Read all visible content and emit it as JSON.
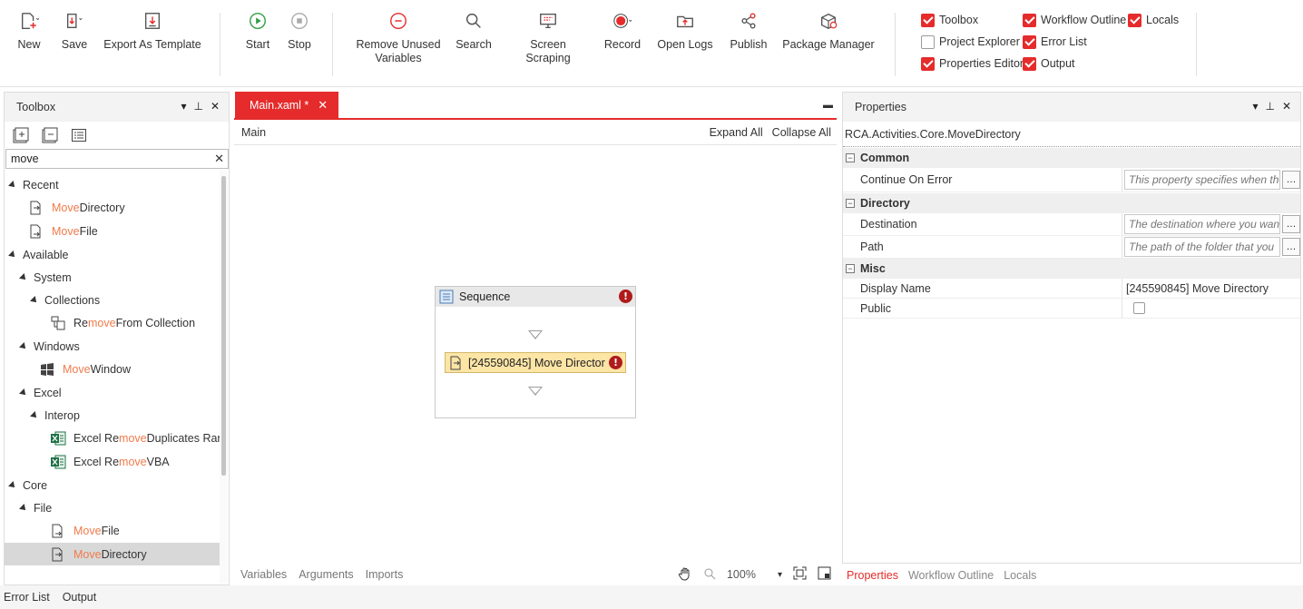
{
  "ribbon": {
    "new": "New",
    "save": "Save",
    "export_template": "Export As Template",
    "start": "Start",
    "stop": "Stop",
    "remove_unused_line1": "Remove Unused",
    "remove_unused_line2": "Variables",
    "search": "Search",
    "screen_scraping": "Screen Scraping",
    "record": "Record",
    "open_logs": "Open Logs",
    "publish": "Publish",
    "package_manager": "Package Manager"
  },
  "view_toggles": {
    "toolbox": {
      "label": "Toolbox",
      "checked": true
    },
    "project_explorer": {
      "label": "Project Explorer",
      "checked": false
    },
    "properties_editor": {
      "label": "Properties Editor",
      "checked": true
    },
    "workflow_outline": {
      "label": "Workflow Outline",
      "checked": true
    },
    "error_list": {
      "label": "Error List",
      "checked": true
    },
    "output": {
      "label": "Output",
      "checked": true
    },
    "locals": {
      "label": "Locals",
      "checked": true
    }
  },
  "toolbox": {
    "title": "Toolbox",
    "search_value": "move",
    "tree": {
      "recent": "Recent",
      "recent_move_directory": {
        "hl": "Move",
        "rest": " Directory"
      },
      "recent_move_file": {
        "hl": "Move",
        "rest": " File"
      },
      "available": "Available",
      "system": "System",
      "collections": "Collections",
      "remove_from_collection": {
        "pre": "Re",
        "hl": "move",
        "rest": " From Collection"
      },
      "windows": "Windows",
      "move_window": {
        "hl": "Move",
        "rest": " Window"
      },
      "excel": "Excel",
      "interop": "Interop",
      "excel_remove_duplicates": {
        "pre": "Excel Re",
        "hl": "move",
        "rest": " Duplicates Range"
      },
      "excel_remove_vba": {
        "pre": "Excel Re",
        "hl": "move",
        "rest": " VBA"
      },
      "core": "Core",
      "file": "File",
      "core_move_file": {
        "hl": "Move",
        "rest": " File"
      },
      "core_move_directory": {
        "hl": "Move",
        "rest": " Directory"
      }
    }
  },
  "designer": {
    "tab_label": "Main.xaml *",
    "breadcrumb": "Main",
    "expand_all": "Expand All",
    "collapse_all": "Collapse All",
    "sequence_title": "Sequence",
    "activity_label": "[245590845] Move Director",
    "footer_tabs": [
      "Variables",
      "Arguments",
      "Imports"
    ],
    "zoom": "100%"
  },
  "properties": {
    "title": "Properties",
    "type_name": "RCA.Activities.Core.MoveDirectory",
    "categories": {
      "common": "Common",
      "directory": "Directory",
      "misc": "Misc"
    },
    "continue_on_error": {
      "name": "Continue On Error",
      "placeholder": "This property specifies when the"
    },
    "destination": {
      "name": "Destination",
      "placeholder": "The destination where you want"
    },
    "path": {
      "name": "Path",
      "placeholder": "The path of the folder that you"
    },
    "display_name": {
      "name": "Display Name",
      "value": "[245590845] Move Directory"
    },
    "public": {
      "name": "Public",
      "checked": false
    },
    "footer_tabs": [
      "Properties",
      "Workflow Outline",
      "Locals"
    ]
  },
  "status_bar": {
    "error_list": "Error List",
    "output": "Output"
  },
  "colors": {
    "accent": "#e52b2b",
    "highlight_text": "#f07b4b",
    "activity_bg": "#fde5a6",
    "error_badge": "#b01b1b"
  }
}
